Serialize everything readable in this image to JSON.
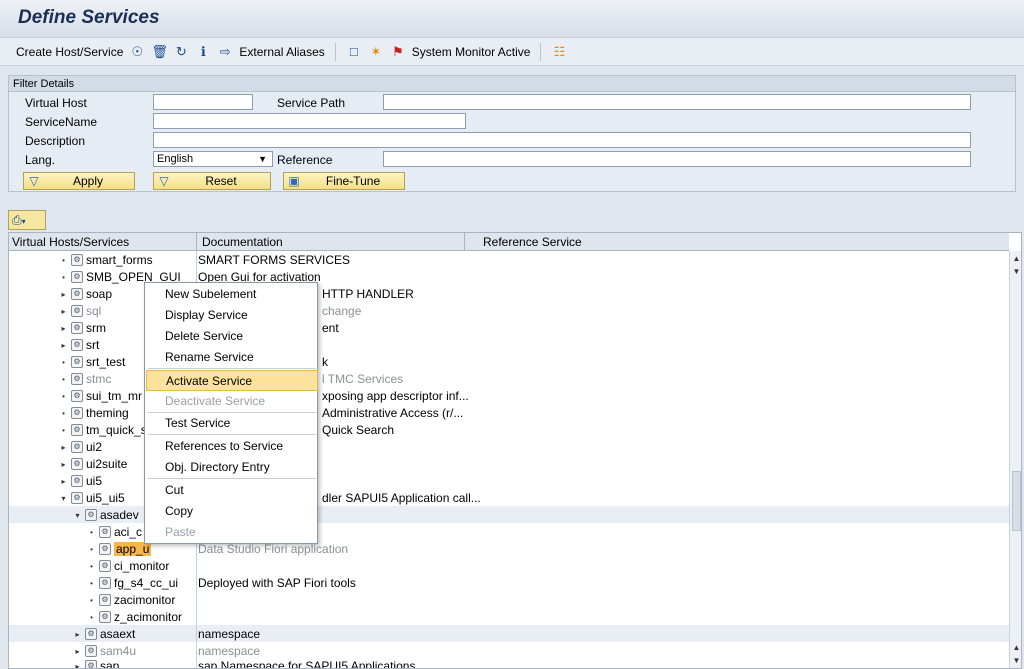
{
  "title": "Define Services",
  "toolbar": {
    "create_label": "Create Host/Service",
    "external_aliases": "External Aliases",
    "system_monitor": "System Monitor Active"
  },
  "filter": {
    "header": "Filter Details",
    "virtual_host_label": "Virtual Host",
    "service_path_label": "Service Path",
    "service_name_label": "ServiceName",
    "description_label": "Description",
    "lang_label": "Lang.",
    "lang_value": "English",
    "reference_label": "Reference",
    "apply": "Apply",
    "reset": "Reset",
    "fine_tune": "Fine-Tune"
  },
  "grid": {
    "col1": "Virtual Hosts/Services",
    "col2": "Documentation",
    "col3": "Reference Service",
    "rows": [
      {
        "name": "smart_forms",
        "doc": "SMART FORMS SERVICES"
      },
      {
        "name": "SMB_OPEN_GUI",
        "doc": "Open Gui for activation"
      },
      {
        "name": "soap",
        "doc": "HTTP HANDLER"
      },
      {
        "name": "sql",
        "doc": "change"
      },
      {
        "name": "srm",
        "doc": "ent"
      },
      {
        "name": "srt",
        "doc": ""
      },
      {
        "name": "srt_test",
        "doc": "k"
      },
      {
        "name": "stmc",
        "doc": "l TMC Services"
      },
      {
        "name": "sui_tm_mr",
        "doc": "xposing app descriptor inf..."
      },
      {
        "name": "theming",
        "doc": "Administrative Access (r/..."
      },
      {
        "name": "tm_quick_s",
        "doc": "Quick Search"
      },
      {
        "name": "ui2",
        "doc": ""
      },
      {
        "name": "ui2suite",
        "doc": ""
      },
      {
        "name": "ui5",
        "doc": ""
      },
      {
        "name": "ui5_ui5",
        "doc": "dler SAPUI5 Application call..."
      },
      {
        "name": "asadev",
        "doc": ""
      },
      {
        "name": "aci_c",
        "doc": ""
      },
      {
        "name": "app_u",
        "doc": "Data Studio Fiori application"
      },
      {
        "name": "ci_monitor",
        "doc": ""
      },
      {
        "name": "fg_s4_cc_ui",
        "doc": "Deployed with SAP Fiori tools"
      },
      {
        "name": "zacimonitor",
        "doc": ""
      },
      {
        "name": "z_acimonitor",
        "doc": ""
      },
      {
        "name": "asaext",
        "doc": "namespace"
      },
      {
        "name": "sam4u",
        "doc": "namespace"
      },
      {
        "name": "sap",
        "doc": "sap Namespace for SAPUI5 Applications"
      }
    ]
  },
  "menu": {
    "items": [
      "New Subelement",
      "Display Service",
      "Delete Service",
      "Rename Service",
      "Activate Service",
      "Deactivate Service",
      "Test Service",
      "References to Service",
      "Obj. Directory Entry",
      "Cut",
      "Copy",
      "Paste"
    ]
  }
}
